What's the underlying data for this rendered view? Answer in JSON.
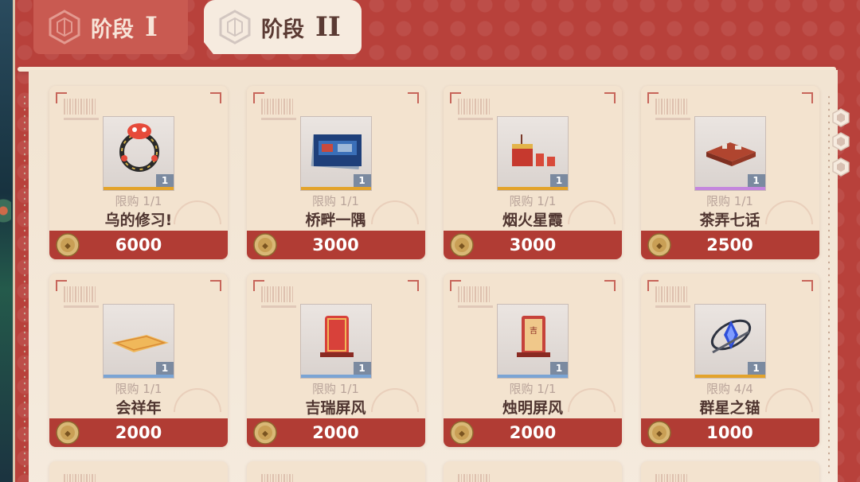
{
  "tabs": [
    {
      "label": "阶段",
      "roman": "I",
      "active": false
    },
    {
      "label": "阶段",
      "roman": "II",
      "active": true
    }
  ],
  "items": [
    {
      "limit": "限购 1/1",
      "name": "乌的修习!",
      "qty": "1",
      "price": "6000",
      "rarity": "#e3a32b",
      "icon": "lion-wreath-icon"
    },
    {
      "limit": "限购 1/1",
      "name": "桥畔一隅",
      "qty": "1",
      "price": "3000",
      "rarity": "#e3a32b",
      "icon": "scene-card-icon"
    },
    {
      "limit": "限购 1/1",
      "name": "烟火星霞",
      "qty": "1",
      "price": "3000",
      "rarity": "#e3a32b",
      "icon": "fireworks-icon"
    },
    {
      "limit": "限购 1/1",
      "name": "茶弄七话",
      "qty": "1",
      "price": "2500",
      "rarity": "#c486dd",
      "icon": "tea-table-icon"
    },
    {
      "limit": "限购 1/1",
      "name": "会祥年",
      "qty": "1",
      "price": "2000",
      "rarity": "#7aa4d4",
      "icon": "rug-icon"
    },
    {
      "limit": "限购 1/1",
      "name": "吉瑞屏风",
      "qty": "1",
      "price": "2000",
      "rarity": "#7aa4d4",
      "icon": "folding-screen-icon"
    },
    {
      "limit": "限购 1/1",
      "name": "烛明屏风",
      "qty": "1",
      "price": "2000",
      "rarity": "#7aa4d4",
      "icon": "candle-screen-icon"
    },
    {
      "limit": "限购 4/4",
      "name": "群星之锚",
      "qty": "1",
      "price": "1000",
      "rarity": "#e3a32b",
      "icon": "star-anchor-icon"
    }
  ]
}
